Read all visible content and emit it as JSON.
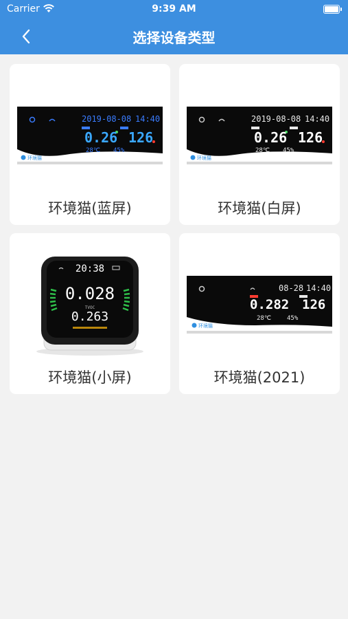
{
  "status_bar": {
    "carrier": "Carrier",
    "time": "9:39 AM"
  },
  "nav": {
    "title": "选择设备类型"
  },
  "devices": [
    {
      "label": "环境猫(蓝屏)",
      "screen": {
        "date": "2019-08-08",
        "clock": "14:40",
        "pm": "0.26",
        "aqi": "126",
        "temp": "28℃",
        "hum": "45%",
        "brand": "环境猫"
      }
    },
    {
      "label": "环境猫(白屏)",
      "screen": {
        "date": "2019-08-08",
        "clock": "14:40",
        "pm": "0.26",
        "aqi": "126",
        "temp": "28℃",
        "hum": "45%",
        "brand": "环境猫"
      }
    },
    {
      "label": "环境猫(小屏)",
      "screen": {
        "clock": "20:38",
        "pm": "0.028",
        "tvoc_label": "TVOC",
        "tvoc": "0.263"
      }
    },
    {
      "label": "环境猫(2021)",
      "screen": {
        "date": "08-28",
        "clock": "14:40",
        "pm": "0.282",
        "aqi": "126",
        "temp": "28℃",
        "hum": "45%",
        "brand": "环境猫"
      }
    }
  ],
  "colors": {
    "header": "#3d8fe0",
    "background": "#f2f2f2",
    "screen": "#0a0a0a"
  }
}
